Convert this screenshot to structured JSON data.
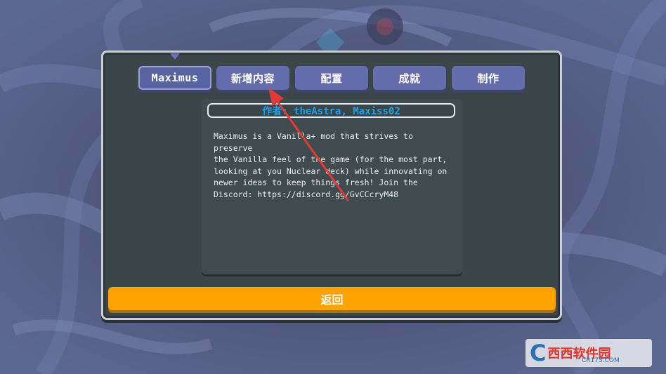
{
  "tabs": [
    {
      "label": "Maximus",
      "active": true
    },
    {
      "label": "新增内容"
    },
    {
      "label": "配置"
    },
    {
      "label": "成就"
    },
    {
      "label": "制作"
    }
  ],
  "mod": {
    "author_line": "作者: theAstra, Maxiss02",
    "description": "Maximus is a Vanilla+ mod that strives to preserve\nthe Vanilla feel of the game (for the most part,\nlooking at you Nuclear deck) while innovating on\nnewer ideas to keep things fresh! Join the\nDiscord: https://discord.gg/GvCCcryM48"
  },
  "back_button": "返回",
  "watermark": {
    "mark": "C",
    "text": "西西软件园",
    "sub": "CR173.COM"
  },
  "colors": {
    "tab": "#646dab",
    "author": "#1da1ec",
    "back": "#fda300",
    "arrow": "#e53935"
  }
}
